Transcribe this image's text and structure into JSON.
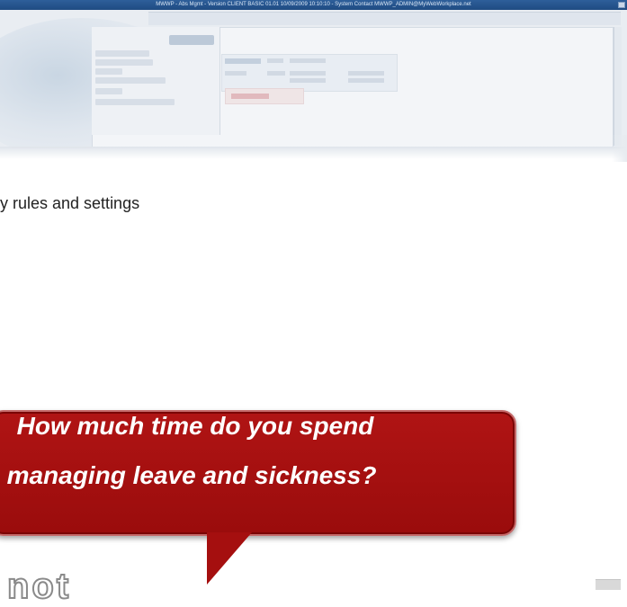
{
  "screenshot": {
    "title_text": "MWWP - Abs Mgmt - Version CLIENT BASIC 01.01 10/09/2009 10:10:10 - System Contact MWWP_ADMIN@MyWebWorkplace.net"
  },
  "body": {
    "text_line": "y rules and settings"
  },
  "bubble": {
    "line1": "How much time do you spend",
    "line2": "managing leave and sickness?"
  },
  "bottom_word": "not",
  "colors": {
    "bubble_red": "#a50f0f",
    "titlebar_blue": "#2e5f9a"
  }
}
